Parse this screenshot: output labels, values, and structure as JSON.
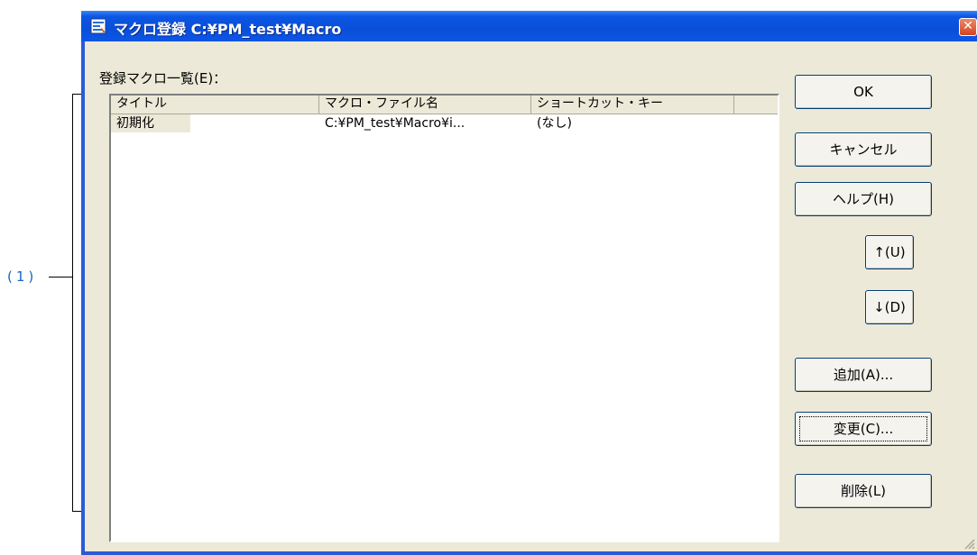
{
  "annotation": {
    "label": "(1)"
  },
  "window": {
    "title": "マクロ登録 C:¥PM_test¥Macro",
    "close_glyph": "✕"
  },
  "list": {
    "caption": "登録マクロ一覧(E)：",
    "columns": [
      "タイトル",
      "マクロ・ファイル名",
      "ショートカット・キー"
    ],
    "rows": [
      {
        "title": "初期化",
        "file": "C:¥PM_test¥Macro¥i...",
        "shortcut": "(なし)"
      }
    ]
  },
  "buttons": {
    "ok": "OK",
    "cancel": "キャンセル",
    "help": "ヘルプ(H)",
    "up": "↑(U)",
    "down": "↓(D)",
    "add": "追加(A)...",
    "change": "変更(C)...",
    "delete": "削除(L)"
  },
  "colors": {
    "titlebar": "#0a4fd8",
    "window_bg": "#ece9d8",
    "annotation": "#1565c0"
  }
}
